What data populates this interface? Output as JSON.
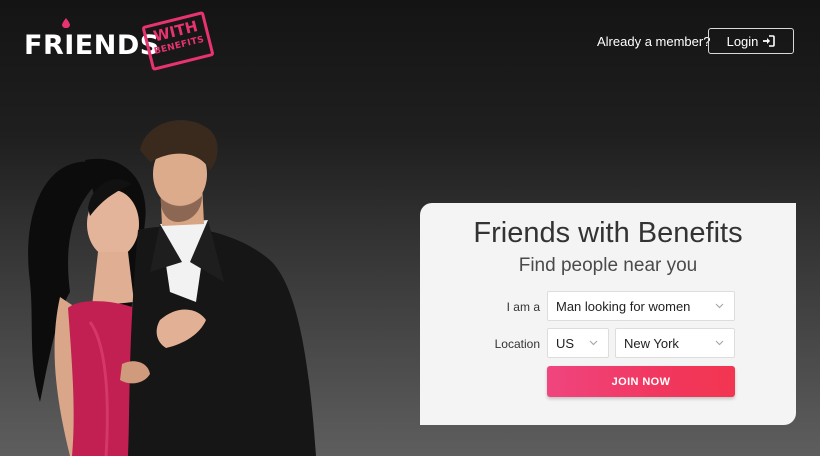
{
  "header": {
    "logo": {
      "main": "FRIENDS",
      "badge_top": "WITH",
      "badge_bottom": "BENEFITS"
    },
    "member_prompt": "Already a member?",
    "login_label": "Login"
  },
  "colors": {
    "accent": "#e8336f",
    "button": "#f1375f",
    "card": "#f4f4f4"
  },
  "icons": {
    "login": "sign-in-icon",
    "dropdown": "chevron-down-icon"
  },
  "signup": {
    "title": "Friends with Benefits",
    "subtitle": "Find people near you",
    "i_am_label": "I am a",
    "i_am_value": "Man looking for women",
    "location_label": "Location",
    "country_value": "US",
    "city_value": "New York",
    "join_label": "JOIN NOW"
  }
}
